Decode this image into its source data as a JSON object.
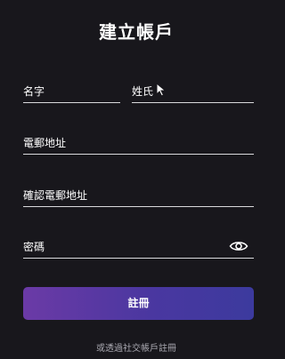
{
  "page": {
    "title": "建立帳戶"
  },
  "form": {
    "first_name": {
      "label": "名字",
      "value": ""
    },
    "last_name": {
      "label": "姓氏",
      "value": ""
    },
    "email": {
      "label": "電郵地址",
      "value": ""
    },
    "confirm_email": {
      "label": "確認電郵地址",
      "value": ""
    },
    "password": {
      "label": "密碼",
      "value": "",
      "toggle_icon": "eye-icon"
    }
  },
  "actions": {
    "register_label": "註冊",
    "social_text": "或透過社交帳戶註冊"
  },
  "colors": {
    "background": "#18171c",
    "button_gradient_start": "#6b3aa6",
    "button_gradient_end": "#3c3a9e",
    "underline": "#d9d9dc"
  }
}
